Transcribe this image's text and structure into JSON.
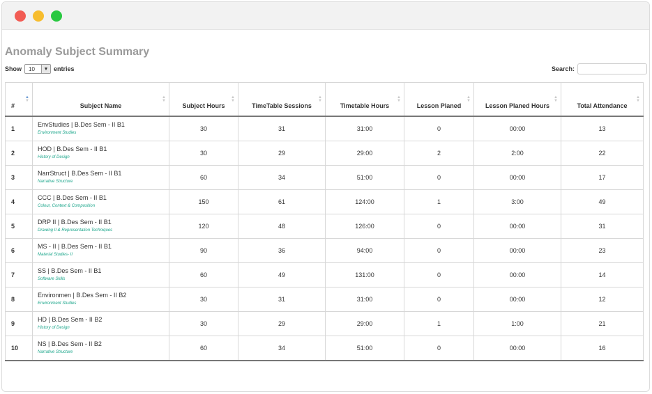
{
  "page": {
    "title": "Anomaly Subject Summary"
  },
  "length": {
    "show_label": "Show",
    "value": "10",
    "entries_label": "entries"
  },
  "search": {
    "label": "Search:",
    "value": "",
    "placeholder": ""
  },
  "table": {
    "headers": [
      "#",
      "Subject Name",
      "Subject Hours",
      "TimeTable Sessions",
      "Timetable Hours",
      "Lesson Planed",
      "Lesson Planed Hours",
      "Total Attendance"
    ],
    "rows": [
      {
        "num": "1",
        "subject": "EnvStudies | B.Des Sem - II B1",
        "subtitle": "Environment Studies",
        "hours": "30",
        "sessions": "31",
        "tt_hours": "31:00",
        "planned": "0",
        "planned_hours": "00:00",
        "attendance": "13"
      },
      {
        "num": "2",
        "subject": "HOD | B.Des Sem - II B1",
        "subtitle": "History of Design",
        "hours": "30",
        "sessions": "29",
        "tt_hours": "29:00",
        "planned": "2",
        "planned_hours": "2:00",
        "attendance": "22"
      },
      {
        "num": "3",
        "subject": "NarrStruct | B.Des Sem - II B1",
        "subtitle": "Narrative Structure",
        "hours": "60",
        "sessions": "34",
        "tt_hours": "51:00",
        "planned": "0",
        "planned_hours": "00:00",
        "attendance": "17"
      },
      {
        "num": "4",
        "subject": "CCC | B.Des Sem - II B1",
        "subtitle": "Colour, Context & Composition",
        "hours": "150",
        "sessions": "61",
        "tt_hours": "124:00",
        "planned": "1",
        "planned_hours": "3:00",
        "attendance": "49"
      },
      {
        "num": "5",
        "subject": "DRP II | B.Des Sem - II B1",
        "subtitle": "Drawing II & Representation Techniques",
        "hours": "120",
        "sessions": "48",
        "tt_hours": "126:00",
        "planned": "0",
        "planned_hours": "00:00",
        "attendance": "31"
      },
      {
        "num": "6",
        "subject": "MS - II | B.Des Sem - II B1",
        "subtitle": "Material Studies- II",
        "hours": "90",
        "sessions": "36",
        "tt_hours": "94:00",
        "planned": "0",
        "planned_hours": "00:00",
        "attendance": "23"
      },
      {
        "num": "7",
        "subject": "SS | B.Des Sem - II B1",
        "subtitle": "Software Skills",
        "hours": "60",
        "sessions": "49",
        "tt_hours": "131:00",
        "planned": "0",
        "planned_hours": "00:00",
        "attendance": "14"
      },
      {
        "num": "8",
        "subject": "Environmen | B.Des Sem - II B2",
        "subtitle": "Environment Studies",
        "hours": "30",
        "sessions": "31",
        "tt_hours": "31:00",
        "planned": "0",
        "planned_hours": "00:00",
        "attendance": "12"
      },
      {
        "num": "9",
        "subject": "HD | B.Des Sem - II B2",
        "subtitle": "History of Design",
        "hours": "30",
        "sessions": "29",
        "tt_hours": "29:00",
        "planned": "1",
        "planned_hours": "1:00",
        "attendance": "21"
      },
      {
        "num": "10",
        "subject": "NS | B.Des Sem - II B2",
        "subtitle": "Narrative Structure",
        "hours": "60",
        "sessions": "34",
        "tt_hours": "51:00",
        "planned": "0",
        "planned_hours": "00:00",
        "attendance": "16"
      }
    ]
  }
}
